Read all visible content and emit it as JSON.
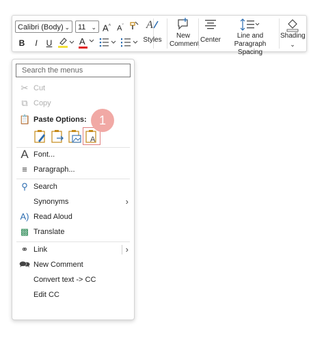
{
  "toolbar": {
    "font_name": "Calibri (Body)",
    "font_size": "11",
    "bold": "B",
    "italic": "I",
    "underline": "U",
    "font_color_letter": "A",
    "styles_label": "Styles",
    "new_comment_label_1": "New",
    "new_comment_label_2": "Comment",
    "center_label": "Center",
    "line_spacing_label_1": "Line and",
    "line_spacing_label_2": "Paragraph Spacing",
    "shading_label": "Shading"
  },
  "menu": {
    "search_placeholder": "Search the menus",
    "cut": "Cut",
    "copy": "Copy",
    "paste_options": "Paste Options:",
    "font": "Font...",
    "paragraph": "Paragraph...",
    "search": "Search",
    "synonyms": "Synonyms",
    "read_aloud": "Read Aloud",
    "translate": "Translate",
    "link": "Link",
    "new_comment": "New Comment",
    "convert_text": "Convert text -> CC",
    "edit_cc": "Edit CC"
  },
  "badge": "1",
  "colors": {
    "highlight": "#f3e03a",
    "font_color_bar": "#e02020",
    "badge": "#f1a9a5",
    "selected_outline": "#e07f7f",
    "paste_icon": "#c58a19",
    "accent_blue": "#2b6cb0"
  }
}
